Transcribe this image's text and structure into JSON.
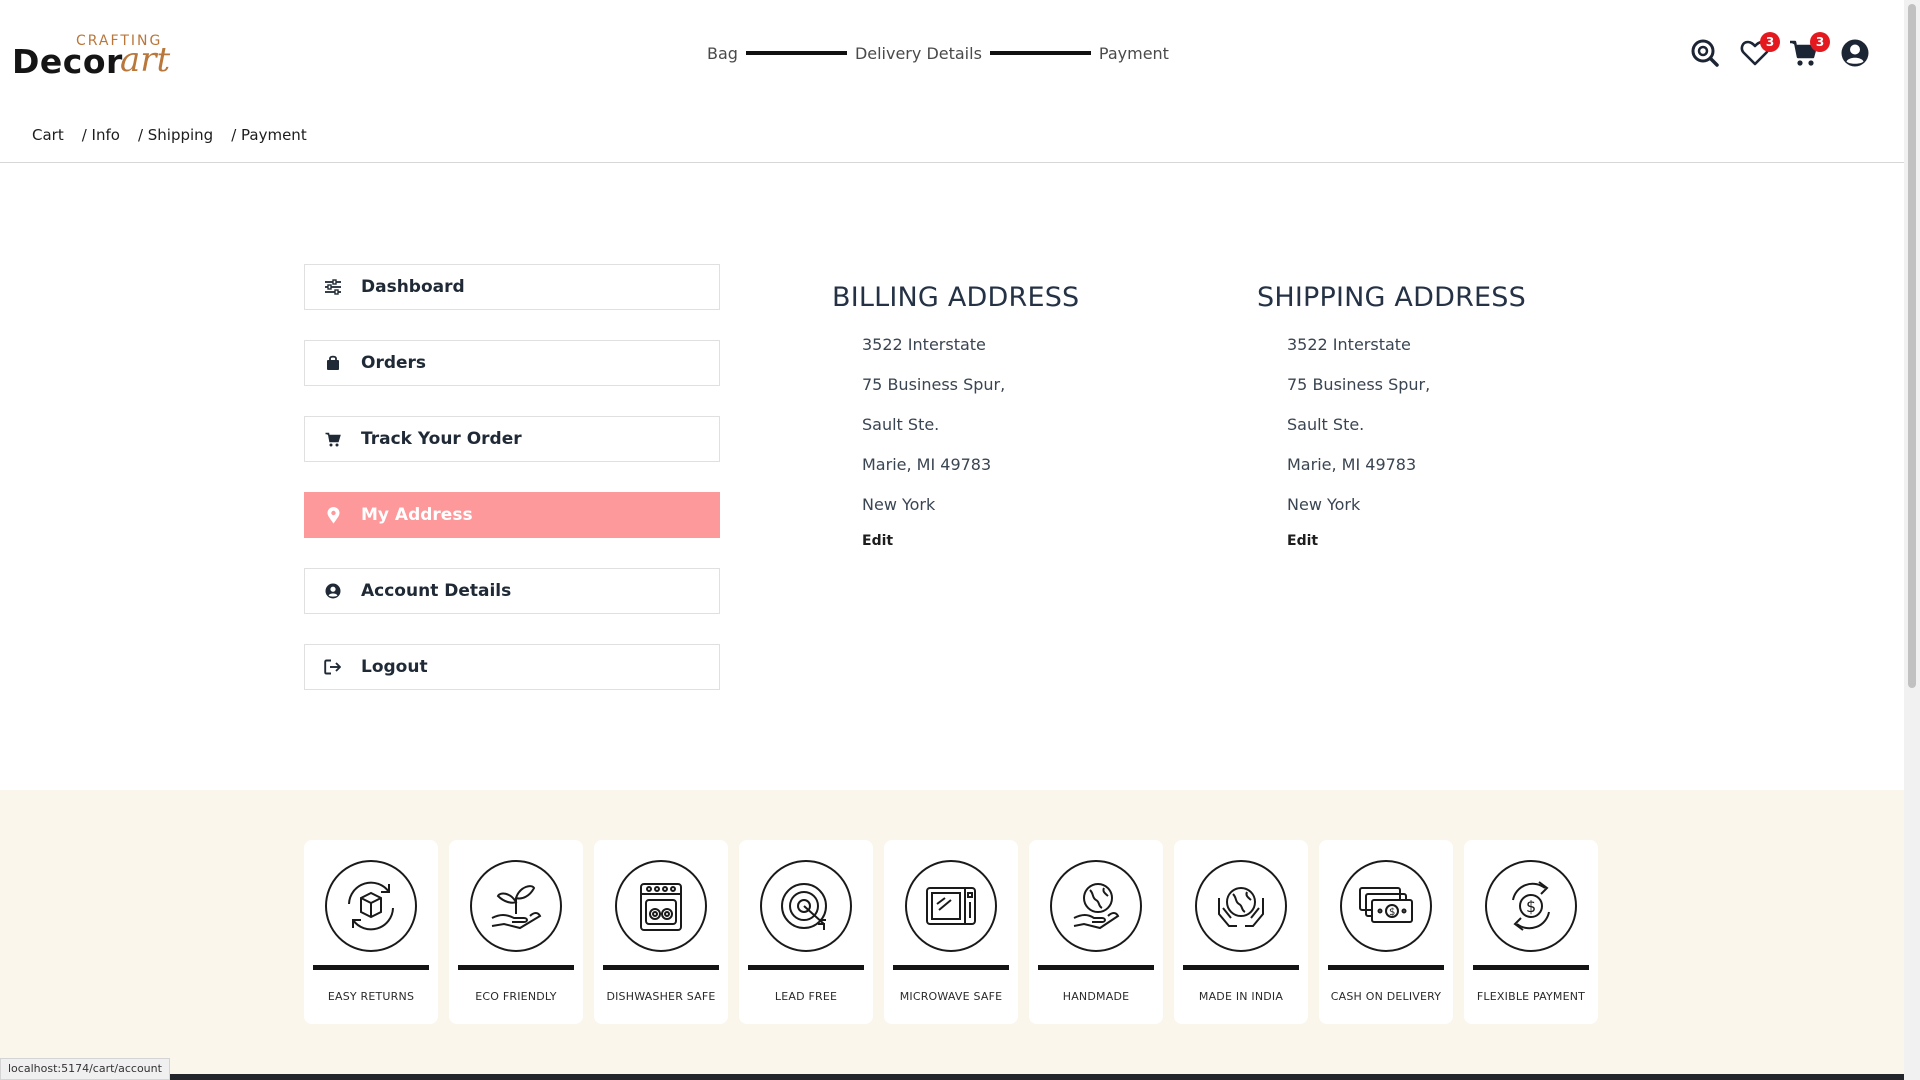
{
  "logo": {
    "top": "CRAFTING",
    "main": "Decor",
    "script": "art"
  },
  "steps": [
    "Bag",
    "Delivery Details",
    "Payment"
  ],
  "header_icons": [
    {
      "name": "search-icon"
    },
    {
      "name": "heart-icon",
      "badge": "3"
    },
    {
      "name": "cart-icon",
      "badge": "3"
    },
    {
      "name": "user-icon"
    }
  ],
  "breadcrumb": [
    "Cart",
    "/ Info",
    "/ Shipping",
    "/ Payment"
  ],
  "menu": [
    {
      "label": "Dashboard",
      "icon": "sliders-icon"
    },
    {
      "label": "Orders",
      "icon": "bag-icon"
    },
    {
      "label": "Track Your Order",
      "icon": "cart-icon"
    },
    {
      "label": "My Address",
      "icon": "location-pin-icon",
      "active": true
    },
    {
      "label": "Account Details",
      "icon": "user-circle-icon"
    },
    {
      "label": "Logout",
      "icon": "logout-icon"
    }
  ],
  "billing": {
    "title": "BILLING ADDRESS",
    "lines": [
      "3522 Interstate",
      "75 Business Spur,",
      "Sault Ste.",
      "Marie, MI 49783",
      "New York"
    ],
    "edit": "Edit"
  },
  "shipping": {
    "title": "SHIPPING ADDRESS",
    "lines": [
      "3522 Interstate",
      "75 Business Spur,",
      "Sault Ste.",
      "Marie, MI 49783",
      "New York"
    ],
    "edit": "Edit"
  },
  "features": [
    {
      "label": "EASY RETURNS",
      "icon": "returns-box-icon"
    },
    {
      "label": "ECO FRIENDLY",
      "icon": "plant-hand-icon"
    },
    {
      "label": "DISHWASHER SAFE",
      "icon": "dishwasher-icon"
    },
    {
      "label": "LEAD FREE",
      "icon": "target-icon"
    },
    {
      "label": "MICROWAVE SAFE",
      "icon": "microwave-icon"
    },
    {
      "label": "HANDMADE",
      "icon": "globe-hand-icon"
    },
    {
      "label": "MADE IN INDIA",
      "icon": "globe-hands-icon"
    },
    {
      "label": "CASH ON DELIVERY",
      "icon": "cash-icon"
    },
    {
      "label": "FLEXIBLE PAYMENT",
      "icon": "dollar-cycle-icon"
    }
  ],
  "status_url": "localhost:5174/cart/account",
  "colors": {
    "active_menu": "#fd999a",
    "badge": "#e3191f",
    "features_bg": "#fbf6ec",
    "logo_accent": "#b9773b"
  }
}
